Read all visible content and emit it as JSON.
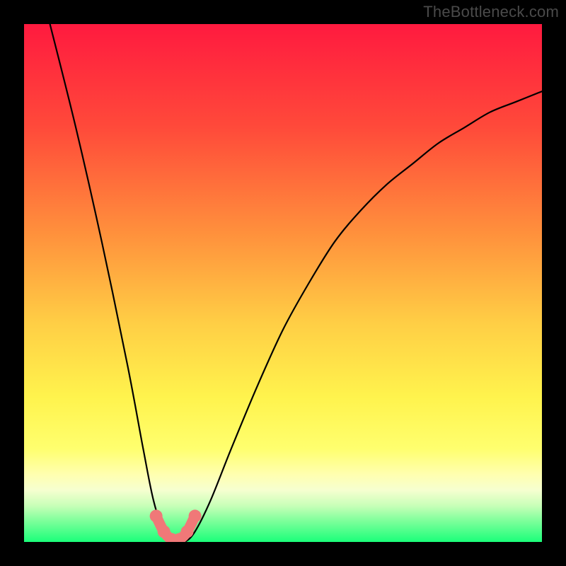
{
  "attribution": {
    "text": "TheBottleneck.com"
  },
  "colors": {
    "frame_bg": "#000000",
    "curve": "#000000",
    "marker_fill": "#f07878",
    "marker_stroke": "#b84040"
  },
  "gradient": {
    "stops": [
      {
        "pct": 0,
        "color": "#ff1a3f"
      },
      {
        "pct": 20,
        "color": "#ff4a3a"
      },
      {
        "pct": 40,
        "color": "#ff8f3c"
      },
      {
        "pct": 58,
        "color": "#ffcf45"
      },
      {
        "pct": 72,
        "color": "#fff34d"
      },
      {
        "pct": 82,
        "color": "#ffff6e"
      },
      {
        "pct": 87,
        "color": "#ffffb0"
      },
      {
        "pct": 90,
        "color": "#f6ffd0"
      },
      {
        "pct": 93,
        "color": "#c8ffb8"
      },
      {
        "pct": 96,
        "color": "#7cff9a"
      },
      {
        "pct": 100,
        "color": "#1bff7a"
      }
    ]
  },
  "chart_data": {
    "type": "line",
    "title": "",
    "xlabel": "",
    "ylabel": "",
    "xlim": [
      0,
      100
    ],
    "ylim": [
      0,
      100
    ],
    "series": [
      {
        "name": "bottleneck-curve",
        "x": [
          5,
          10,
          15,
          20,
          23,
          25,
          27,
          29,
          31,
          33,
          36,
          40,
          45,
          50,
          55,
          60,
          65,
          70,
          75,
          80,
          85,
          90,
          95,
          100
        ],
        "y": [
          100,
          80,
          58,
          34,
          18,
          8,
          2,
          0,
          0,
          2,
          8,
          18,
          30,
          41,
          50,
          58,
          64,
          69,
          73,
          77,
          80,
          83,
          85,
          87
        ]
      }
    ],
    "markers": {
      "name": "highlighted-minimum",
      "x": [
        25.5,
        27.0,
        28.5,
        30.0,
        31.5,
        33.0
      ],
      "y": [
        5.0,
        2.0,
        0.5,
        0.5,
        2.0,
        5.0
      ]
    }
  }
}
